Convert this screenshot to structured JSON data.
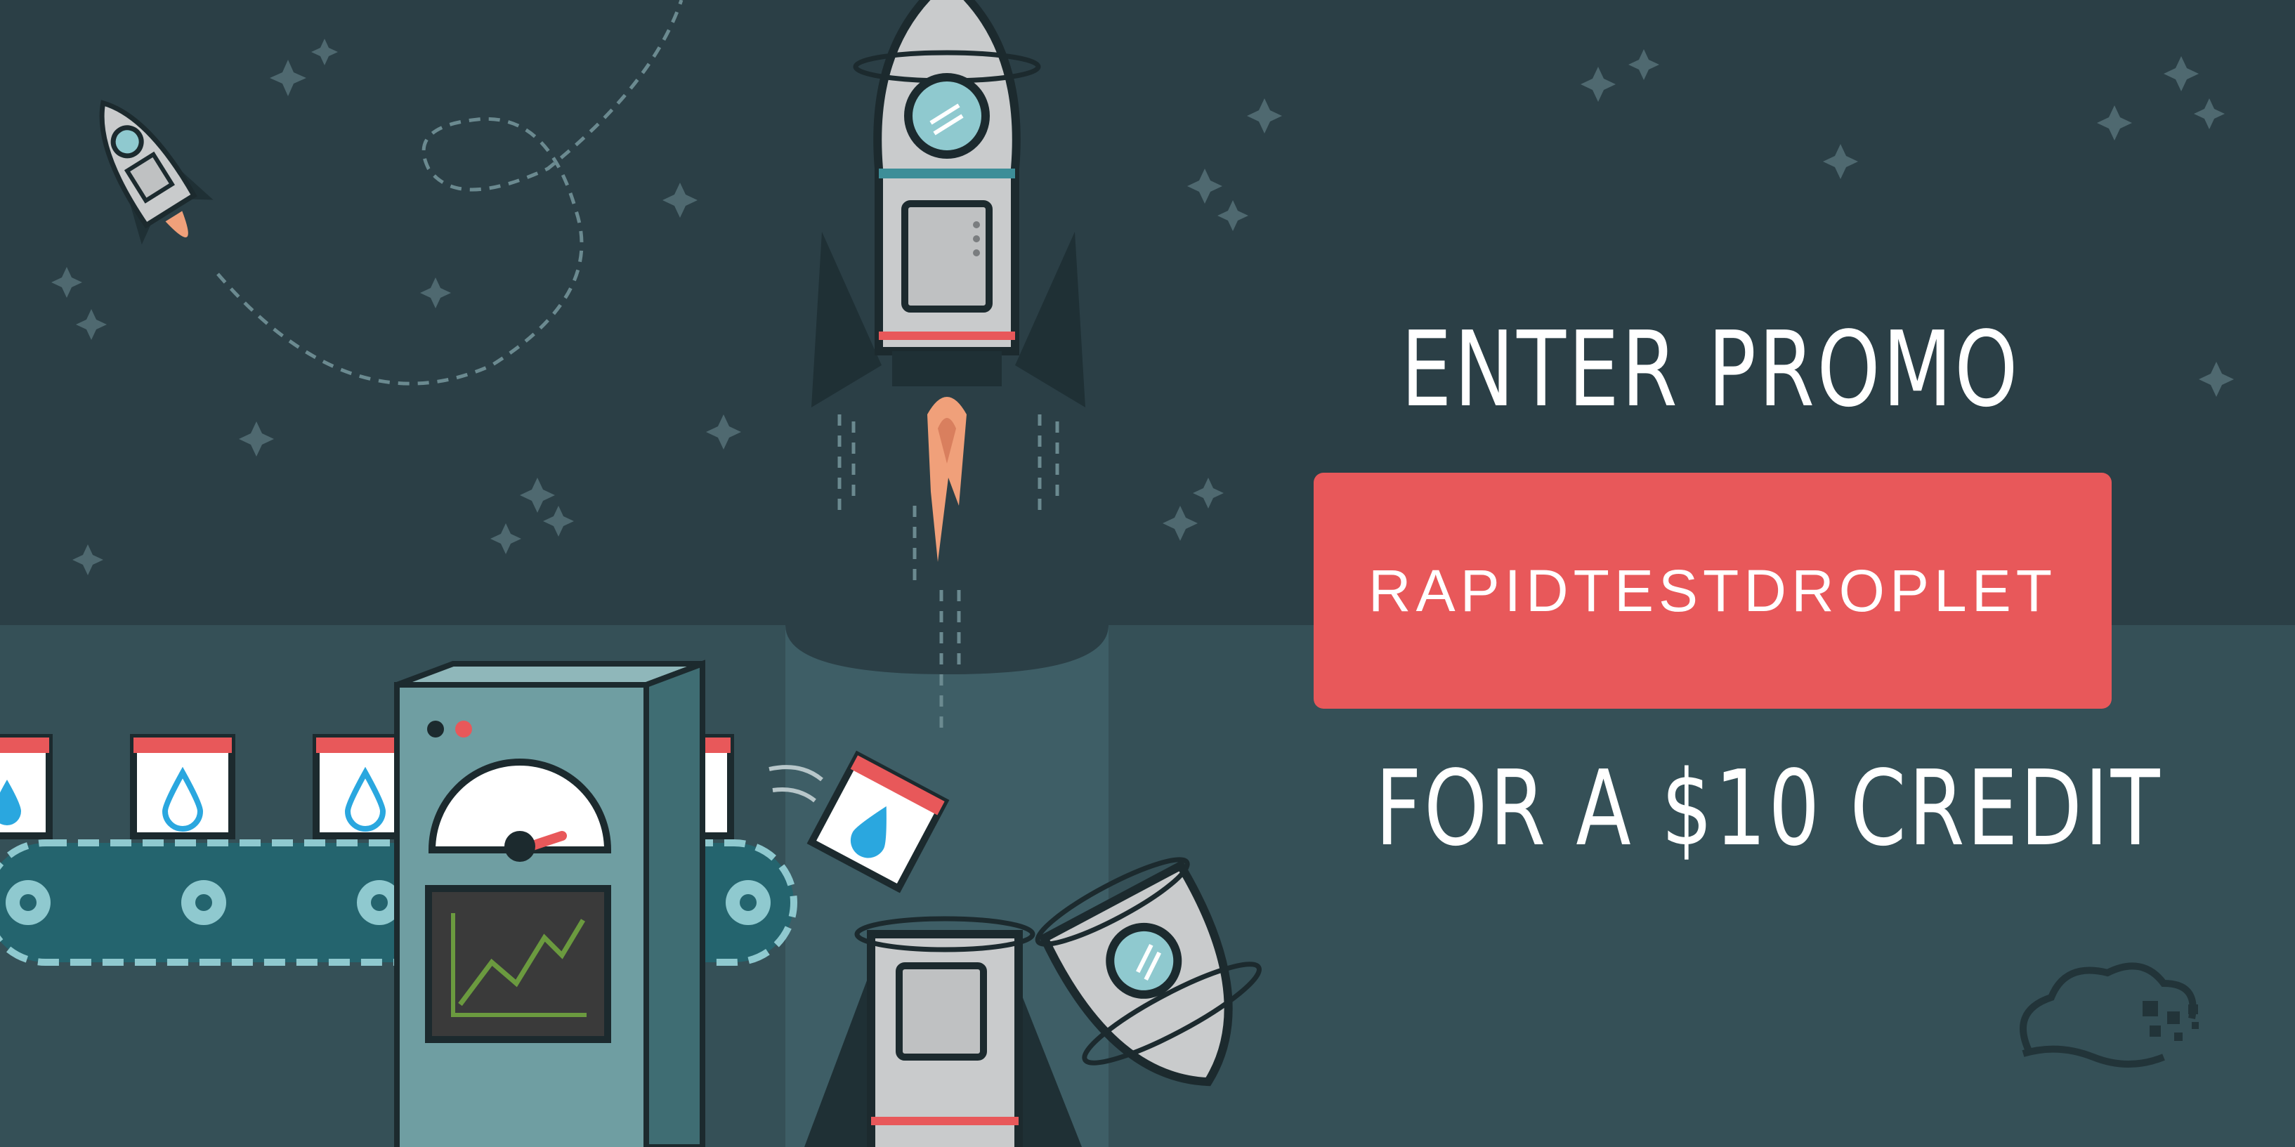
{
  "promo": {
    "heading": "ENTER PROMO",
    "code": "RAPIDTESTDROPLET",
    "footer": "FOR A $10 CREDIT"
  },
  "colors": {
    "background_dark": "#2b3f46",
    "background_lower": "#355057",
    "promo_box": "#e8585a",
    "machine": "#6f9ea2",
    "rocket_body": "#c9cbcc",
    "flame": "#f0a07a",
    "water_drop": "#2aa7df"
  },
  "icons": [
    "rocket-icon",
    "star-icon",
    "conveyor-belt",
    "gear-icon",
    "water-drop-icon",
    "gauge-icon",
    "chart-screen-icon",
    "cloud-logo-icon"
  ]
}
